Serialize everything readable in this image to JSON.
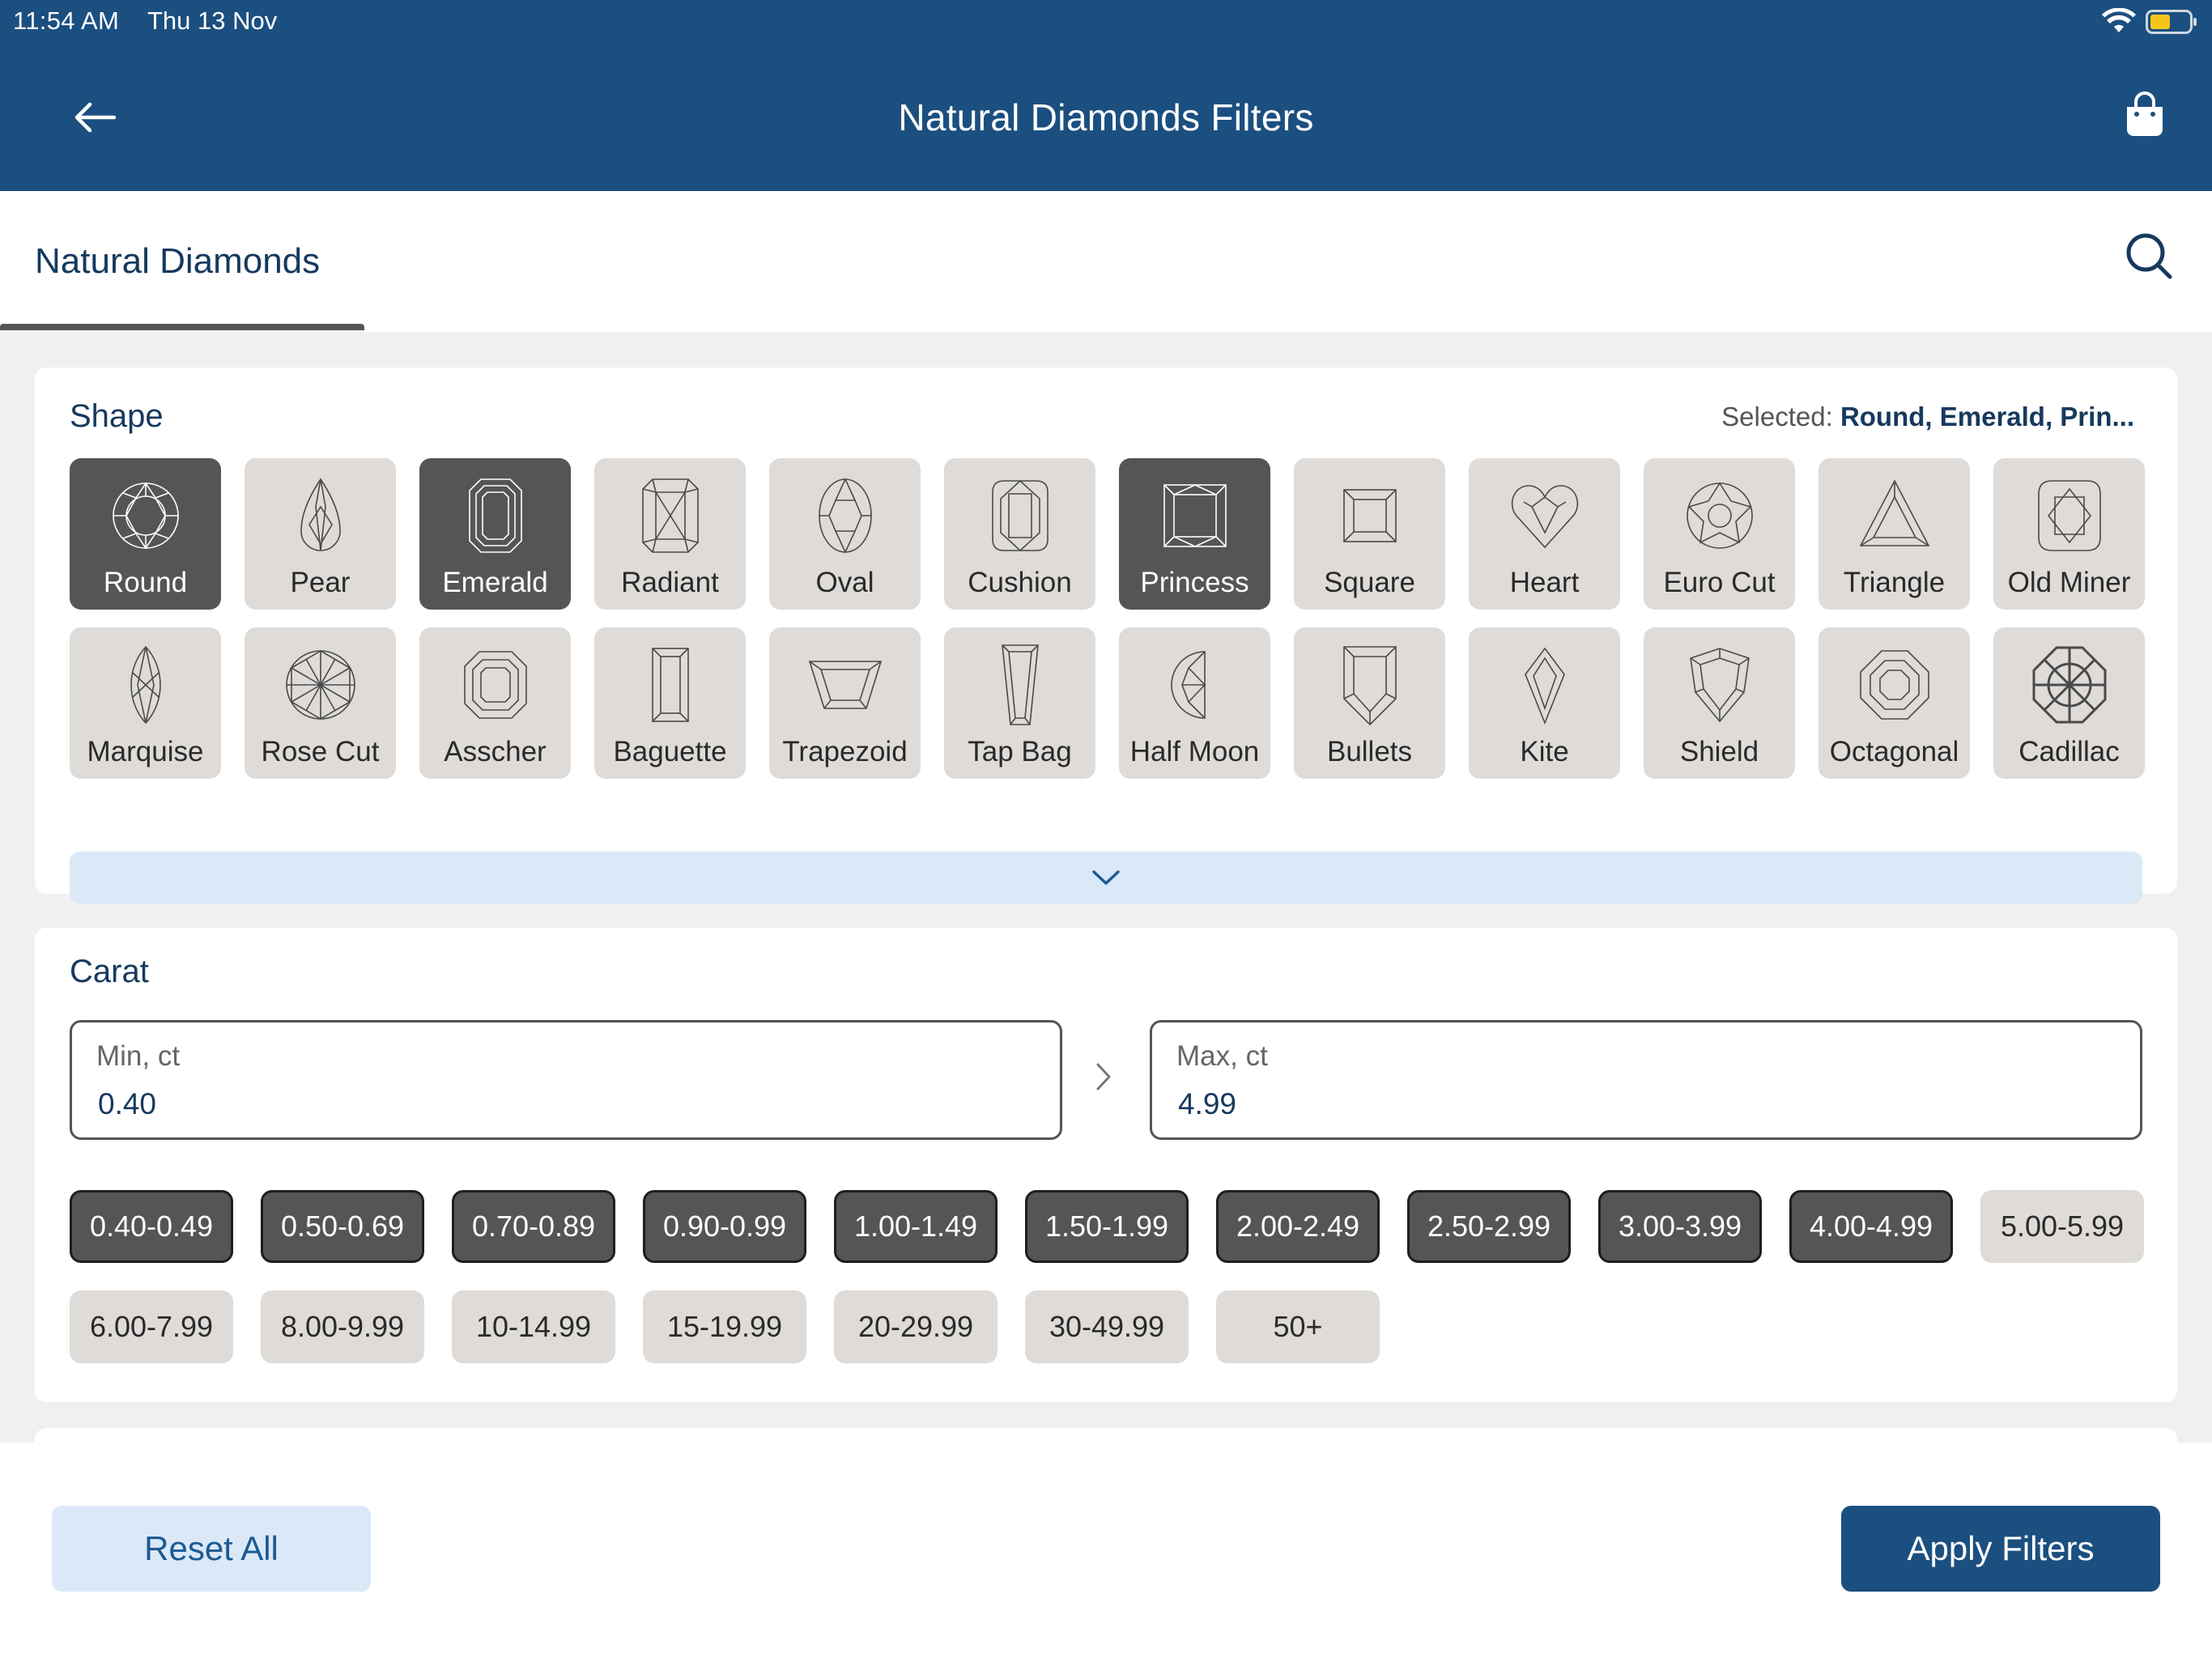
{
  "status_bar": {
    "time": "11:54 AM",
    "date": "Thu 13 Nov"
  },
  "header": {
    "title": "Natural Diamonds Filters",
    "back_icon": "arrow-left-icon",
    "bag_icon": "shopping-bag-icon"
  },
  "tabs": {
    "active_label": "Natural Diamonds",
    "search_icon": "search-icon"
  },
  "shape": {
    "title": "Shape",
    "selected_prefix": "Selected: ",
    "selected_value": "Round, Emerald, Prin...",
    "items": [
      {
        "label": "Round",
        "selected": true
      },
      {
        "label": "Pear",
        "selected": false
      },
      {
        "label": "Emerald",
        "selected": true
      },
      {
        "label": "Radiant",
        "selected": false
      },
      {
        "label": "Oval",
        "selected": false
      },
      {
        "label": "Cushion",
        "selected": false
      },
      {
        "label": "Princess",
        "selected": true
      },
      {
        "label": "Square",
        "selected": false
      },
      {
        "label": "Heart",
        "selected": false
      },
      {
        "label": "Euro Cut",
        "selected": false
      },
      {
        "label": "Triangle",
        "selected": false
      },
      {
        "label": "Old Miner",
        "selected": false
      },
      {
        "label": "Marquise",
        "selected": false
      },
      {
        "label": "Rose Cut",
        "selected": false
      },
      {
        "label": "Asscher",
        "selected": false
      },
      {
        "label": "Baguette",
        "selected": false
      },
      {
        "label": "Trapezoid",
        "selected": false
      },
      {
        "label": "Tap Bag",
        "selected": false
      },
      {
        "label": "Half Moon",
        "selected": false
      },
      {
        "label": "Bullets",
        "selected": false
      },
      {
        "label": "Kite",
        "selected": false
      },
      {
        "label": "Shield",
        "selected": false
      },
      {
        "label": "Octagonal",
        "selected": false
      },
      {
        "label": "Cadillac",
        "selected": false
      }
    ],
    "expand_icon": "chevron-down-icon"
  },
  "carat": {
    "title": "Carat",
    "min_label": "Min, ct",
    "min_value": "0.40",
    "max_label": "Max, ct",
    "max_value": "4.99",
    "ranges": [
      {
        "label": "0.40-0.49",
        "selected": true
      },
      {
        "label": "0.50-0.69",
        "selected": true
      },
      {
        "label": "0.70-0.89",
        "selected": true
      },
      {
        "label": "0.90-0.99",
        "selected": true
      },
      {
        "label": "1.00-1.49",
        "selected": true
      },
      {
        "label": "1.50-1.99",
        "selected": true
      },
      {
        "label": "2.00-2.49",
        "selected": true
      },
      {
        "label": "2.50-2.99",
        "selected": true
      },
      {
        "label": "3.00-3.99",
        "selected": true
      },
      {
        "label": "4.00-4.99",
        "selected": true
      },
      {
        "label": "5.00-5.99",
        "selected": false
      },
      {
        "label": "6.00-7.99",
        "selected": false
      },
      {
        "label": "8.00-9.99",
        "selected": false
      },
      {
        "label": "10-14.99",
        "selected": false
      },
      {
        "label": "15-19.99",
        "selected": false
      },
      {
        "label": "20-29.99",
        "selected": false
      },
      {
        "label": "30-49.99",
        "selected": false
      },
      {
        "label": "50+",
        "selected": false
      }
    ]
  },
  "footer": {
    "reset_label": "Reset All",
    "apply_label": "Apply Filters"
  },
  "colors": {
    "brand": "#1b4f80",
    "selected_tile": "#555555",
    "unselected_tile": "#dedbd8",
    "light_accent": "#dbe8f7"
  }
}
